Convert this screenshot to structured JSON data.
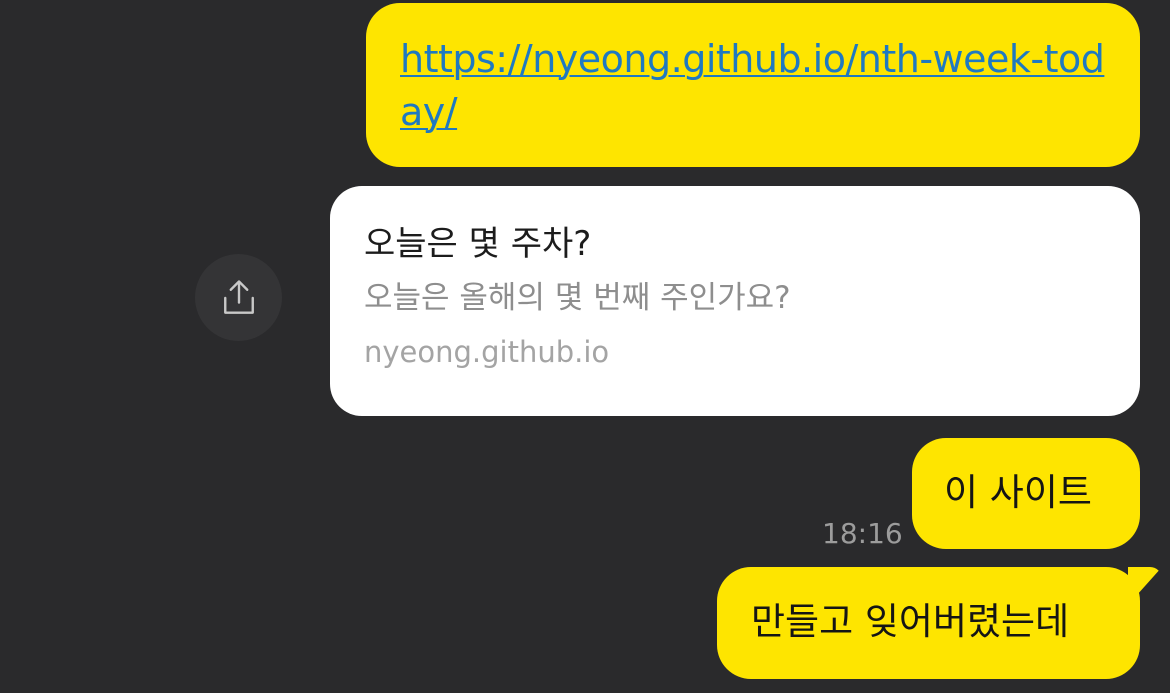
{
  "chat": {
    "link_message": {
      "url_text": "https://nyeong.github.io/nth-week-today/",
      "href": "https://nyeong.github.io/nth-week-today/"
    },
    "preview_card": {
      "title": "오늘은 몇 주차?",
      "description": "오늘은 올해의 몇 번째 주인가요?",
      "domain": "nyeong.github.io"
    },
    "share_button": {
      "icon": "share-icon"
    },
    "messages": [
      {
        "text": "이 사이트",
        "time": "18:16"
      },
      {
        "text": "만들고 잊어버렸는데"
      }
    ]
  },
  "colors": {
    "background": "#2a2a2c",
    "bubble": "#fee500",
    "link": "#1f79c1",
    "card": "#ffffff",
    "secondary_text": "#8e8e8e"
  }
}
